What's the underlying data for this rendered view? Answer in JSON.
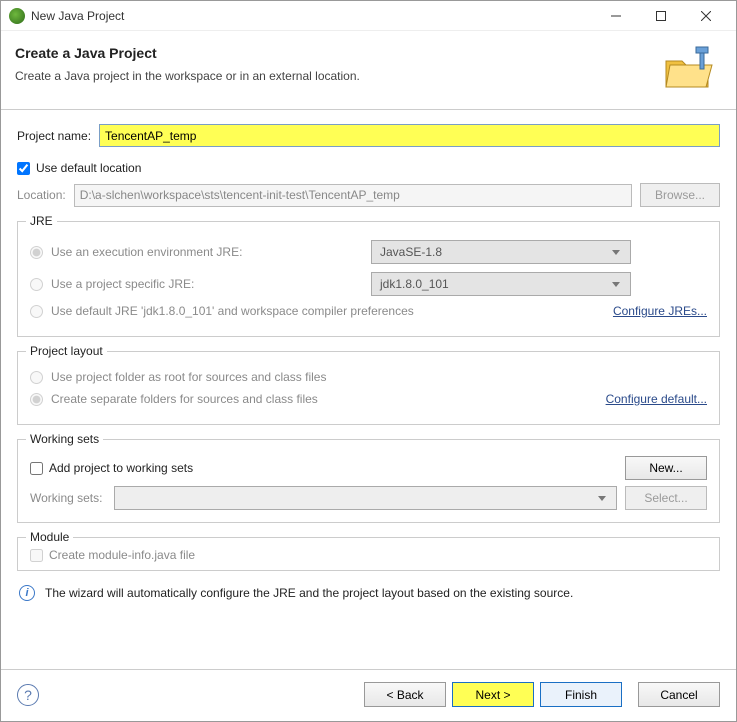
{
  "window": {
    "title": "New Java Project"
  },
  "header": {
    "title": "Create a Java Project",
    "desc": "Create a Java project in the workspace or in an external location."
  },
  "project": {
    "name_label": "Project name:",
    "name_value": "TencentAP_temp",
    "use_default_label": "Use default location",
    "location_label": "Location:",
    "location_value": "D:\\a-slchen\\workspace\\sts\\tencent-init-test\\TencentAP_temp",
    "browse": "Browse..."
  },
  "jre": {
    "title": "JRE",
    "opt1": "Use an execution environment JRE:",
    "opt1_value": "JavaSE-1.8",
    "opt2": "Use a project specific JRE:",
    "opt2_value": "jdk1.8.0_101",
    "opt3": "Use default JRE 'jdk1.8.0_101' and workspace compiler preferences",
    "configure": "Configure JREs..."
  },
  "layout": {
    "title": "Project layout",
    "opt1": "Use project folder as root for sources and class files",
    "opt2": "Create separate folders for sources and class files",
    "configure": "Configure default..."
  },
  "working": {
    "title": "Working sets",
    "add_label": "Add project to working sets",
    "new": "New...",
    "ws_label": "Working sets:",
    "select": "Select..."
  },
  "module": {
    "title": "Module",
    "create": "Create module-info.java file"
  },
  "info": "The wizard will automatically configure the JRE and the project layout based on the existing source.",
  "footer": {
    "back": "< Back",
    "next": "Next >",
    "finish": "Finish",
    "cancel": "Cancel"
  }
}
